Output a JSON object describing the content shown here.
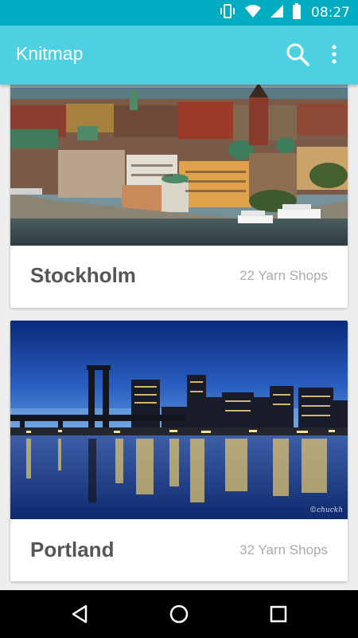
{
  "status_bar": {
    "time": "08:27",
    "icons": [
      "vibrate-icon",
      "wifi-icon",
      "signal-icon",
      "battery-icon"
    ]
  },
  "app_bar": {
    "title": "Knitmap",
    "actions": [
      "search-icon",
      "more-vert-icon"
    ]
  },
  "cities": [
    {
      "name": "Stockholm",
      "shops": "22 Yarn Shops"
    },
    {
      "name": "Portland",
      "shops": "32 Yarn Shops"
    }
  ],
  "image_credit": "©chuckh",
  "nav_bar": {
    "buttons": [
      "back-icon",
      "home-icon",
      "recents-icon"
    ]
  },
  "colors": {
    "status_bar": "#00acc1",
    "app_bar": "#4dd0e1",
    "background": "#eeeeee",
    "card": "#ffffff",
    "title_text": "#555555",
    "meta_text": "#aaaaaa"
  }
}
